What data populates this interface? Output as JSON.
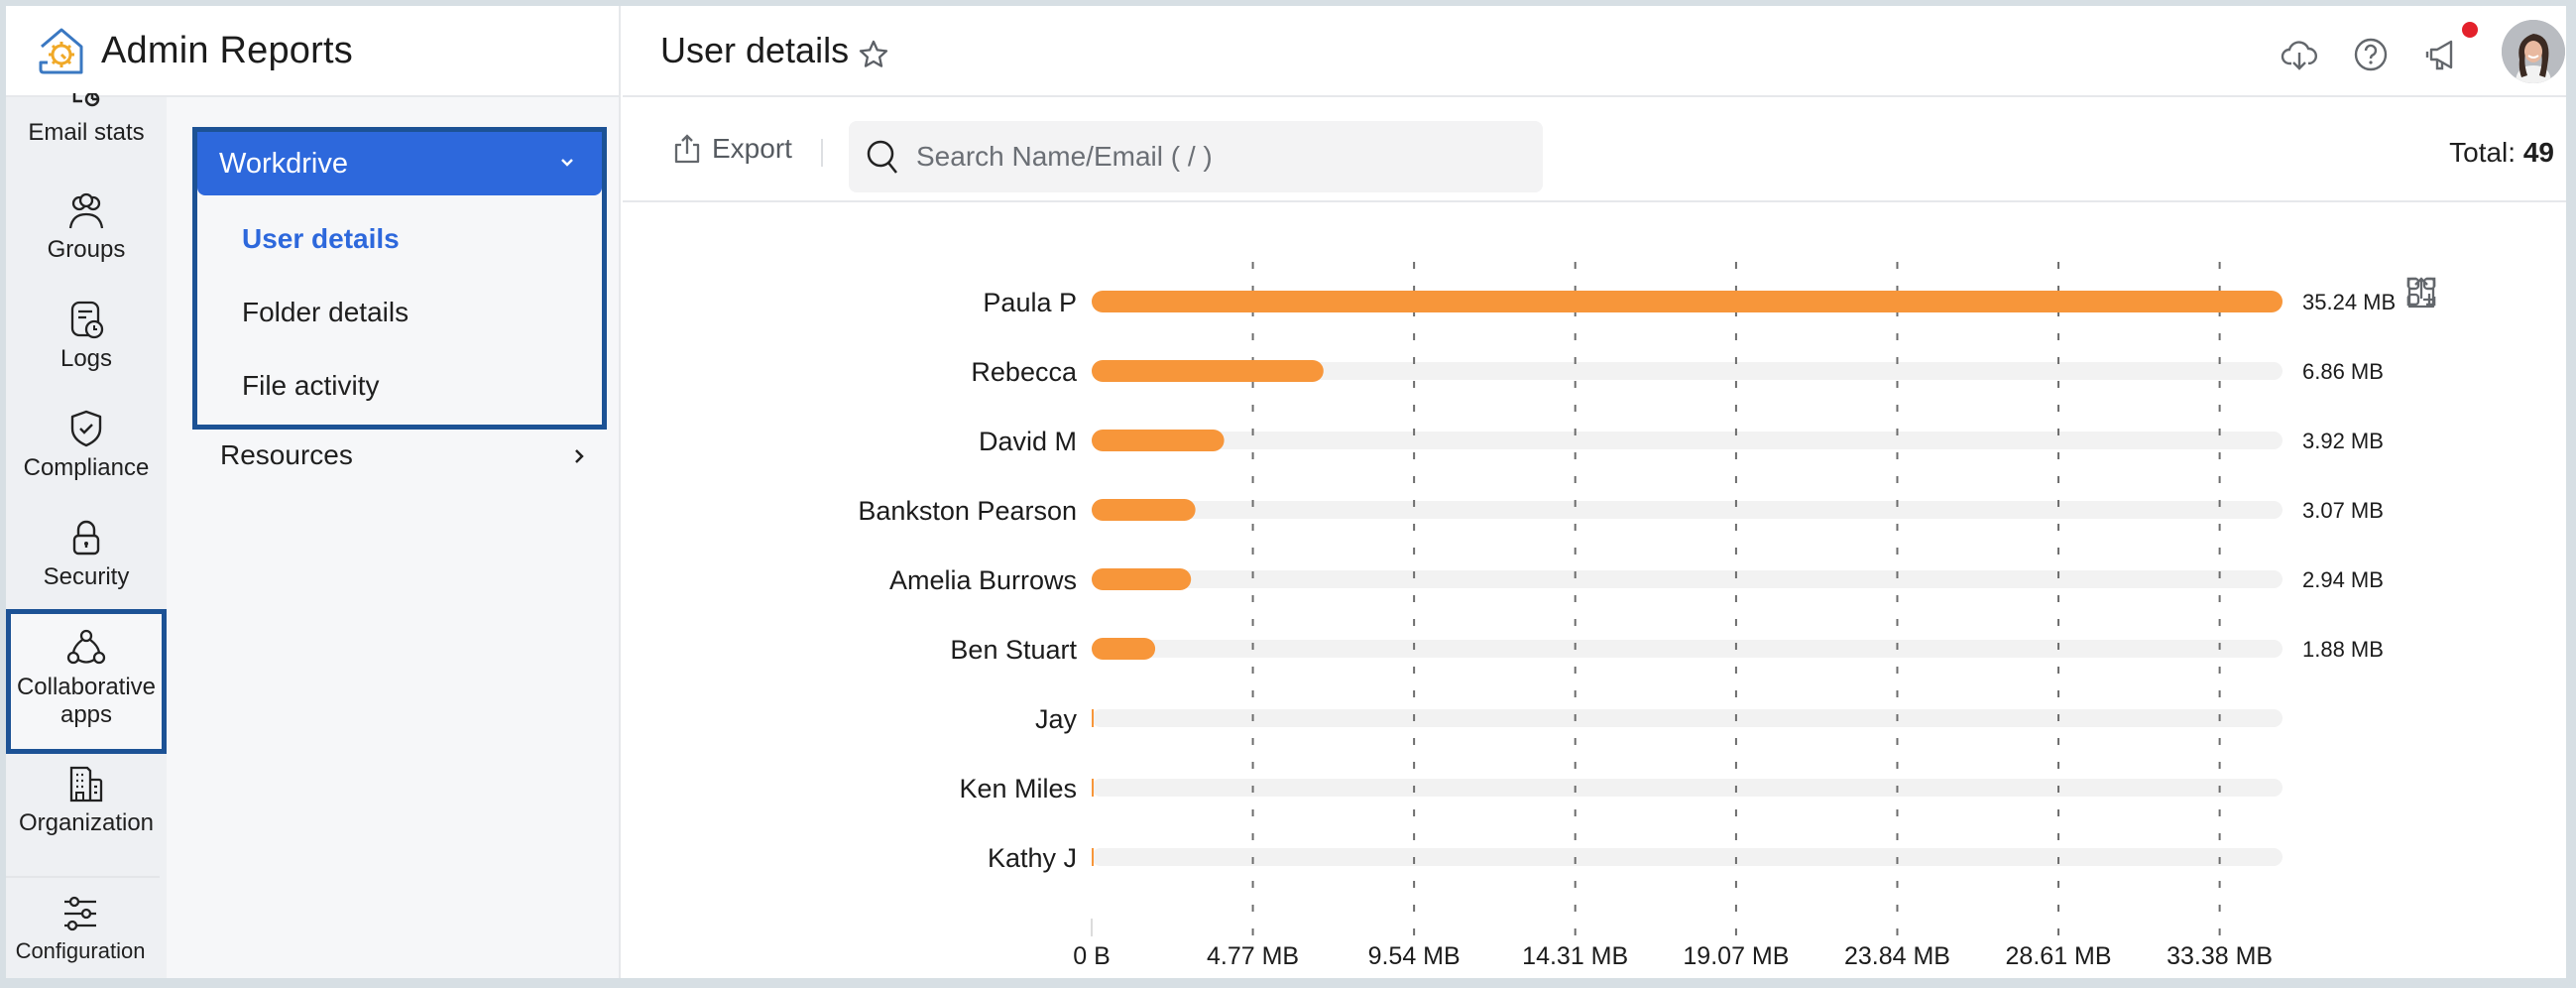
{
  "app": {
    "title": "Admin Reports"
  },
  "rail": {
    "items": [
      {
        "label": "Email stats",
        "icon": "email-stats-icon"
      },
      {
        "label": "Groups",
        "icon": "groups-icon"
      },
      {
        "label": "Logs",
        "icon": "logs-icon"
      },
      {
        "label": "Compliance",
        "icon": "shield-check-icon"
      },
      {
        "label": "Security",
        "icon": "lock-icon"
      },
      {
        "label_line1": "Collaborative",
        "label_line2": "apps",
        "icon": "collaborative-apps-icon",
        "selected": true
      },
      {
        "label": "Organization",
        "icon": "building-icon"
      },
      {
        "label": "Configuration",
        "icon": "sliders-icon"
      }
    ]
  },
  "submenu": {
    "group": "Workdrive",
    "items": [
      {
        "label": "User details",
        "active": true
      },
      {
        "label": "Folder details"
      },
      {
        "label": "File activity"
      }
    ],
    "other": "Resources"
  },
  "header": {
    "page_title": "User details",
    "icons": [
      "cloud-download-icon",
      "help-icon",
      "announcement-icon",
      "avatar"
    ],
    "has_notification": true
  },
  "toolbar": {
    "export_label": "Export",
    "search_placeholder": "Search Name/Email ( / )",
    "search_value": "",
    "total_label": "Total:",
    "total_value": "49"
  },
  "colors": {
    "accent": "#2d68dc",
    "highlight_border": "#1c5295",
    "bar": "#f7963a",
    "track": "#f2f2f2",
    "notification": "#e3212b"
  },
  "chart_data": {
    "type": "bar",
    "orientation": "horizontal",
    "title": "",
    "xlabel": "",
    "ylabel": "",
    "unit": "MB",
    "categories": [
      "Paula P",
      "Rebecca",
      "David M",
      "Bankston Pearson",
      "Amelia Burrows",
      "Ben Stuart",
      "Jay",
      "Ken Miles",
      "Kathy J"
    ],
    "values": [
      35.24,
      6.86,
      3.92,
      3.07,
      2.94,
      1.88,
      0,
      0,
      0
    ],
    "value_labels": [
      "35.24 MB",
      "6.86 MB",
      "3.92 MB",
      "3.07 MB",
      "2.94 MB",
      "1.88 MB",
      "",
      "",
      ""
    ],
    "xlim": [
      0,
      35.24
    ],
    "x_ticks": [
      0,
      4.77,
      9.54,
      14.31,
      19.07,
      23.84,
      28.61,
      33.38
    ],
    "x_tick_labels": [
      "0 B",
      "4.77 MB",
      "9.54 MB",
      "14.31 MB",
      "19.07 MB",
      "23.84 MB",
      "28.61 MB",
      "33.38 MB"
    ],
    "grid": "vertical dashed",
    "tools": [
      "add-widget-icon",
      "fullscreen-icon",
      "share-icon"
    ]
  }
}
